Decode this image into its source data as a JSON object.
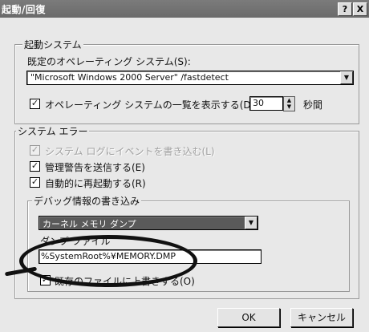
{
  "window": {
    "title": "起動/回復",
    "help": "?",
    "close": "X"
  },
  "startup": {
    "group_label": "起動システム",
    "default_os_label": "既定のオペレーティング システム(S):",
    "default_os_value": "\"Microsoft Windows 2000 Server\" /fastdetect",
    "show_list_label": "オペレーティング システムの一覧を表示する(D)",
    "seconds_value": "30",
    "seconds_unit": "秒間"
  },
  "system_error": {
    "group_label": "システム エラー",
    "write_event_label": "システム ログにイベントを書き込む(L)",
    "admin_alert_label": "管理警告を送信する(E)",
    "auto_restart_label": "自動的に再起動する(R)"
  },
  "debug": {
    "group_label": "デバッグ情報の書き込み",
    "type_value": "カーネル メモリ ダンプ",
    "dump_file_label": "ダンプ ファイル",
    "dump_file_value": "%SystemRoot%¥MEMORY.DMP",
    "overwrite_label": "既存のファイルに上書きする(O)"
  },
  "buttons": {
    "ok": "OK",
    "cancel": "キャンセル"
  }
}
